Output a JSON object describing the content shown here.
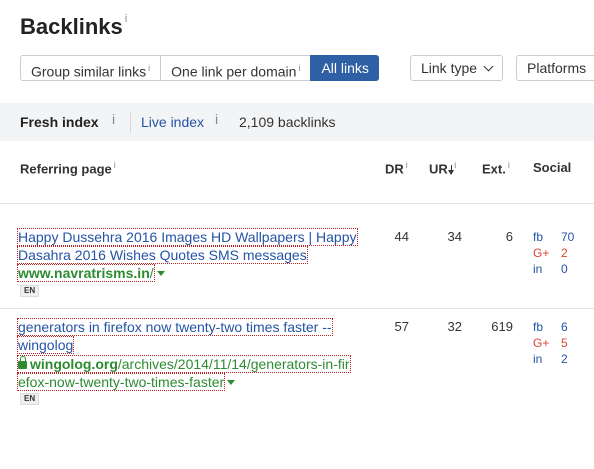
{
  "header": {
    "title": "Backlinks",
    "info": "i"
  },
  "filters": {
    "group_similar": "Group similar links",
    "one_per_domain": "One link per domain",
    "all_links": "All links",
    "link_type": "Link type",
    "platforms": "Platforms",
    "info": "i"
  },
  "index_bar": {
    "fresh": "Fresh index",
    "live": "Live index",
    "count": "2,109 backlinks",
    "info": "i"
  },
  "table": {
    "headers": {
      "referring_page": "Referring page",
      "dr": "DR",
      "ur": "UR",
      "ext": "Ext.",
      "social": "Social",
      "info": "i"
    },
    "rows": [
      {
        "title_line1": "Happy Dussehra 2016 Images HD Wallpapers | Happy",
        "title_line2": "Dasahra 2016 Wishes Quotes SMS messages",
        "url_domain": "www.navratrisms.in",
        "url_path": "/",
        "lang": "EN",
        "dr": "44",
        "ur": "34",
        "ext": "6",
        "social": {
          "fb_label": "fb",
          "fb": "70",
          "g_label": "G+",
          "g": "2",
          "in_label": "in",
          "in": "0"
        }
      },
      {
        "title_line1": "generators in firefox now twenty-two times faster --",
        "title_line2": "wingolog",
        "url_domain": "wingolog.org",
        "url_path1": "/archives/2014/11/14/generators-in-fir",
        "url_path2": "efox-now-twenty-two-times-faster",
        "lang": "EN",
        "dr": "57",
        "ur": "32",
        "ext": "619",
        "social": {
          "fb_label": "fb",
          "fb": "6",
          "g_label": "G+",
          "g": "5",
          "in_label": "in",
          "in": "2"
        }
      }
    ]
  },
  "colors": {
    "accent": "#2f5fa4",
    "link": "#2553a6",
    "url": "#2e8b32",
    "gplus": "#dd4433"
  }
}
